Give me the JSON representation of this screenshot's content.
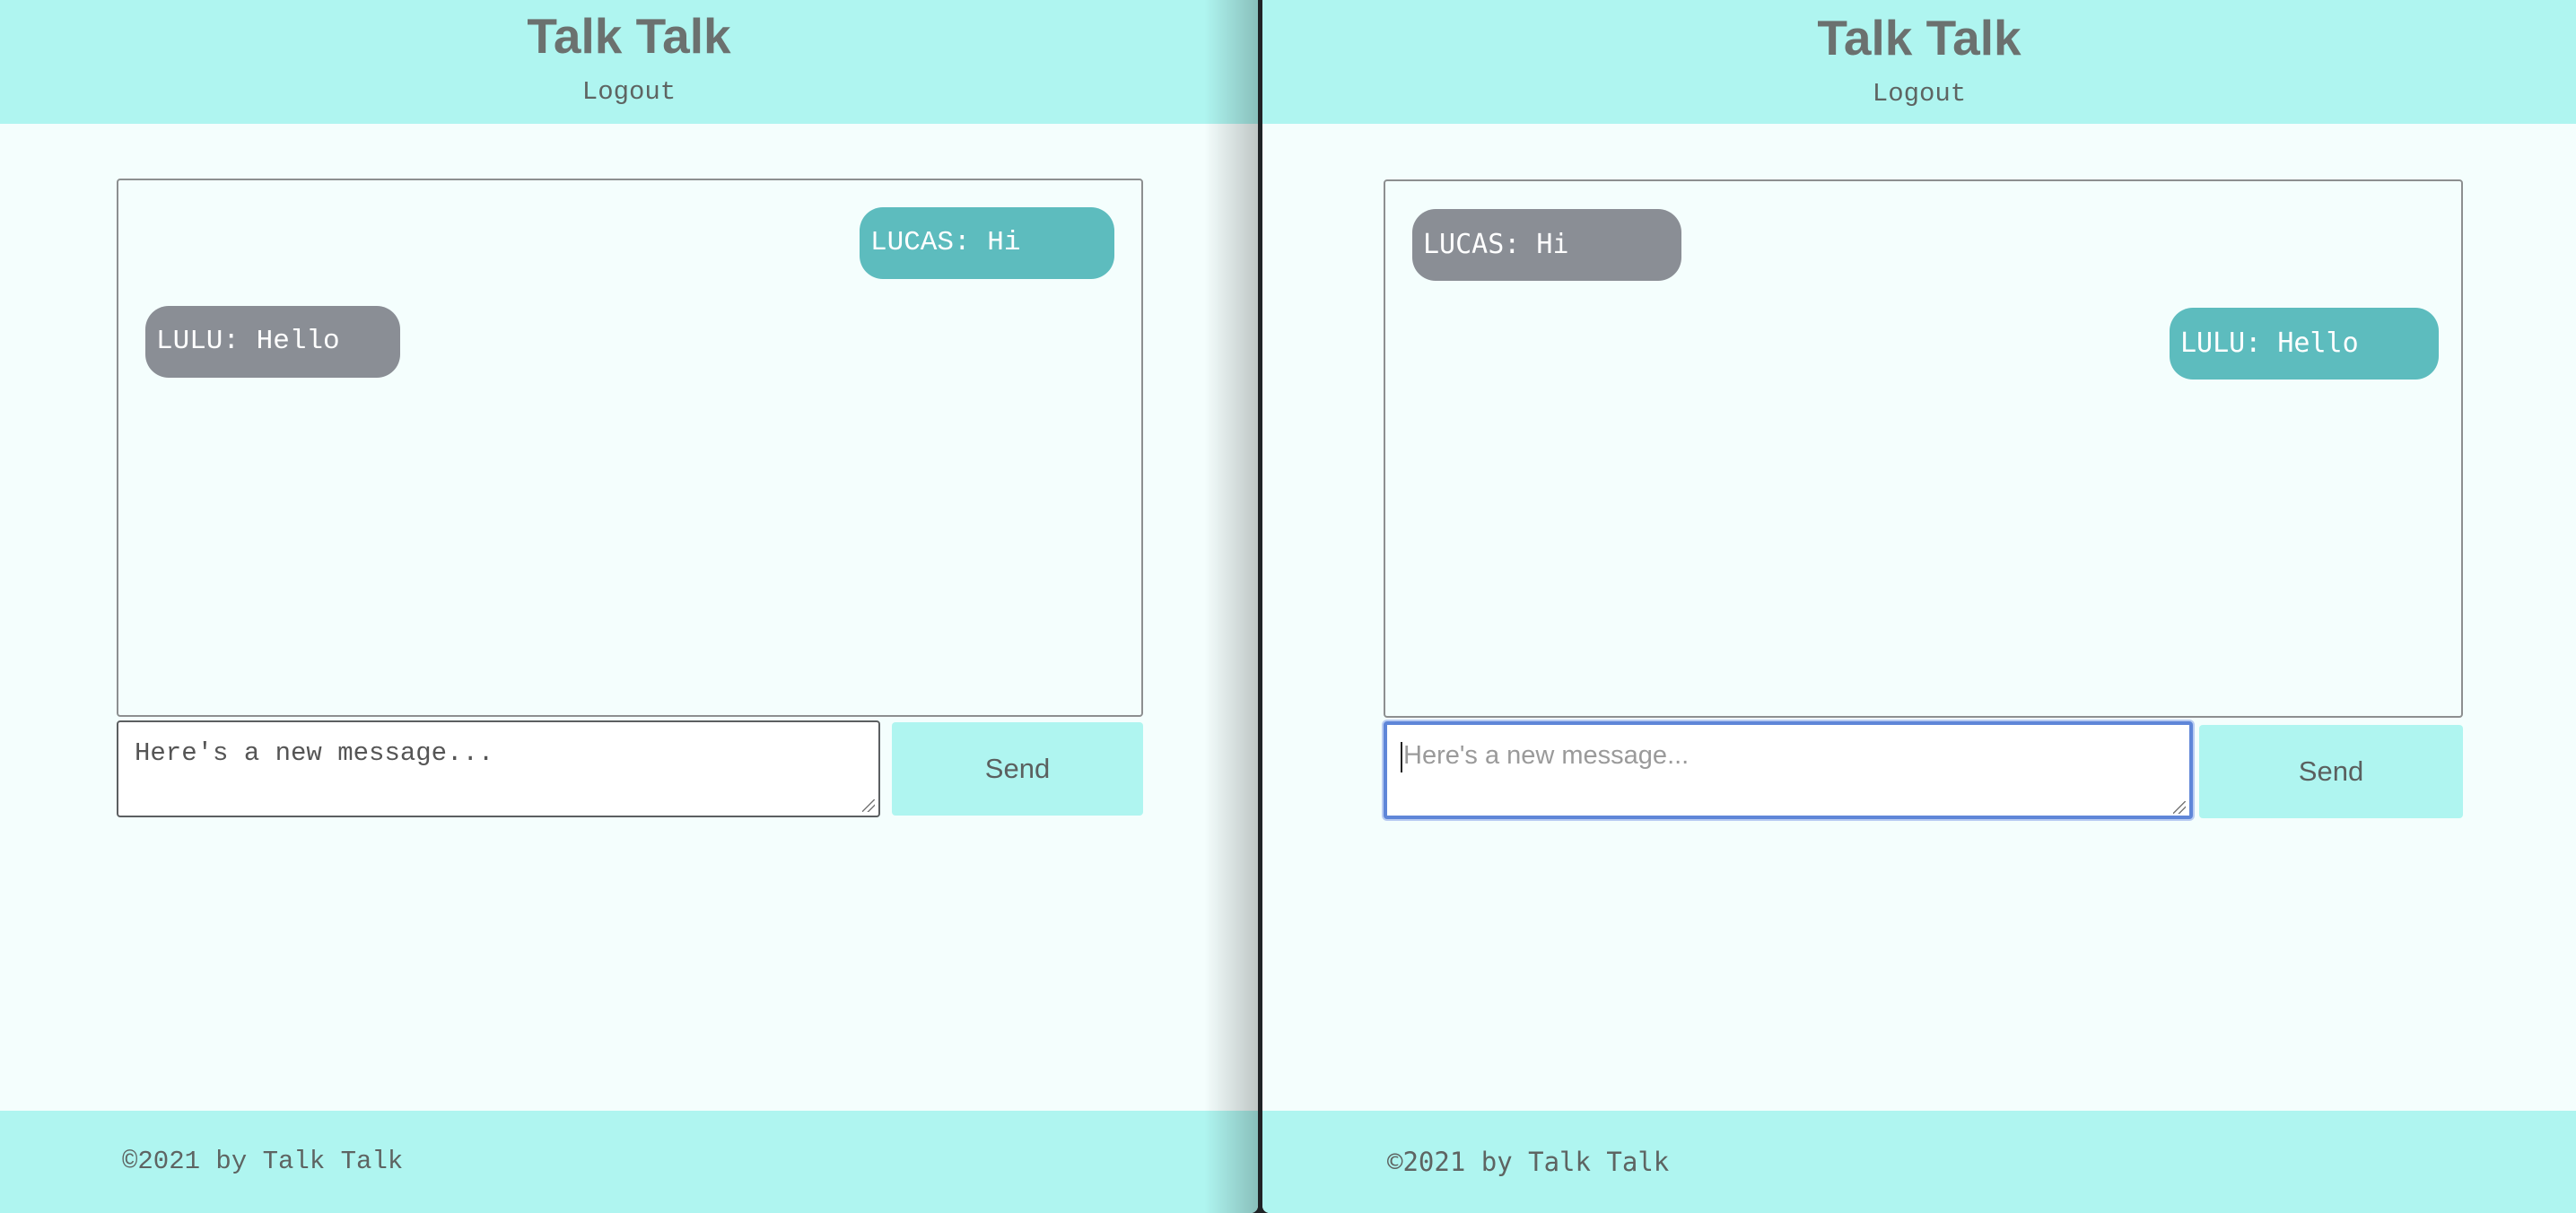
{
  "left_window": {
    "header": {
      "title": "Talk Talk",
      "logout_label": "Logout"
    },
    "messages": [
      {
        "sender": "LUCAS",
        "text": "Hi",
        "display": "LUCAS: Hi",
        "side": "right"
      },
      {
        "sender": "LULU",
        "text": "Hello",
        "display": "LULU: Hello",
        "side": "left"
      }
    ],
    "composer": {
      "placeholder": "Here's a new message...",
      "value": "",
      "send_label": "Send"
    },
    "footer": {
      "text": "©2021 by Talk Talk"
    }
  },
  "right_window": {
    "header": {
      "title": "Talk Talk",
      "logout_label": "Logout"
    },
    "messages": [
      {
        "sender": "LUCAS",
        "text": "Hi",
        "display": "LUCAS: Hi",
        "side": "left"
      },
      {
        "sender": "LULU",
        "text": "Hello",
        "display": "LULU: Hello",
        "side": "right"
      }
    ],
    "composer": {
      "placeholder": "Here's a new message...",
      "value": "",
      "send_label": "Send",
      "focused": true
    },
    "footer": {
      "text": "©2021 by Talk Talk"
    }
  },
  "colors": {
    "header_bg": "#aff5f0",
    "page_bg": "#f4fefd",
    "own_bubble": "#5dbcbe",
    "other_bubble": "#8a8e95",
    "text": "#6b716f",
    "focus_ring": "#5f86d8"
  }
}
